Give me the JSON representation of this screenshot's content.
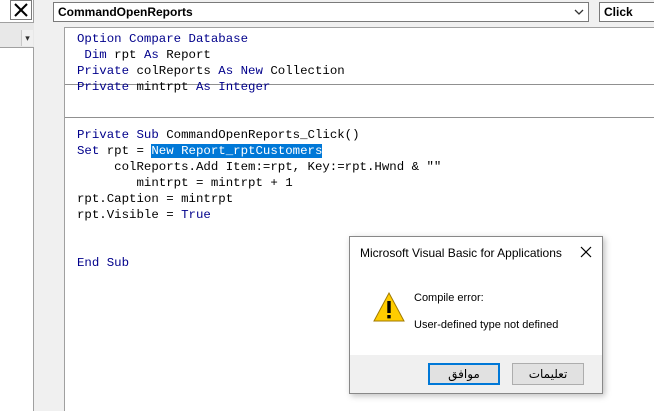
{
  "window": {
    "object_combo_value": "CommandOpenReports",
    "procedure_combo_value": "Click"
  },
  "code": {
    "lines": [
      {
        "segments": [
          {
            "t": "Option Compare Database",
            "k": true
          }
        ]
      },
      {
        "segments": [
          {
            "t": " Dim",
            "k": true
          },
          {
            "t": " rpt ",
            "k": false
          },
          {
            "t": "As",
            "k": true
          },
          {
            "t": " Report",
            "k": false
          }
        ]
      },
      {
        "segments": [
          {
            "t": "Private",
            "k": true
          },
          {
            "t": " colReports ",
            "k": false
          },
          {
            "t": "As New",
            "k": true
          },
          {
            "t": " Collection",
            "k": false
          }
        ]
      },
      {
        "segments": [
          {
            "t": "Private",
            "k": true
          },
          {
            "t": " mintrpt ",
            "k": false
          },
          {
            "t": "As Integer",
            "k": true
          }
        ]
      },
      {
        "segments": []
      },
      {
        "segments": []
      },
      {
        "segments": [
          {
            "t": "Private Sub",
            "k": true
          },
          {
            "t": " CommandOpenReports_Click()",
            "k": false
          }
        ]
      },
      {
        "segments": [
          {
            "t": "Set",
            "k": true
          },
          {
            "t": " rpt = ",
            "k": false
          },
          {
            "t": "New Report_rptCustomers",
            "s": true
          }
        ]
      },
      {
        "segments": [
          {
            "t": "     colReports.Add Item:=rpt, Key:=rpt.Hwnd & \"\"",
            "k": false
          }
        ]
      },
      {
        "segments": [
          {
            "t": "        mintrpt = mintrpt + 1",
            "k": false
          }
        ]
      },
      {
        "segments": [
          {
            "t": "rpt.Caption = mintrpt",
            "k": false
          }
        ]
      },
      {
        "segments": [
          {
            "t": "rpt.Visible = ",
            "k": false
          },
          {
            "t": "True",
            "k": true
          }
        ]
      },
      {
        "segments": []
      },
      {
        "segments": []
      },
      {
        "segments": [
          {
            "t": "End Sub",
            "k": true
          }
        ]
      }
    ]
  },
  "dialog": {
    "title": "Microsoft Visual Basic for Applications",
    "heading": "Compile error:",
    "message": "User-defined type not defined",
    "ok_label": "موافق",
    "help_label": "تعليمات",
    "icon": "warning-icon"
  },
  "colors": {
    "keyword": "#00008b",
    "selection": "#0078d7",
    "warning": "#ffcc00"
  }
}
